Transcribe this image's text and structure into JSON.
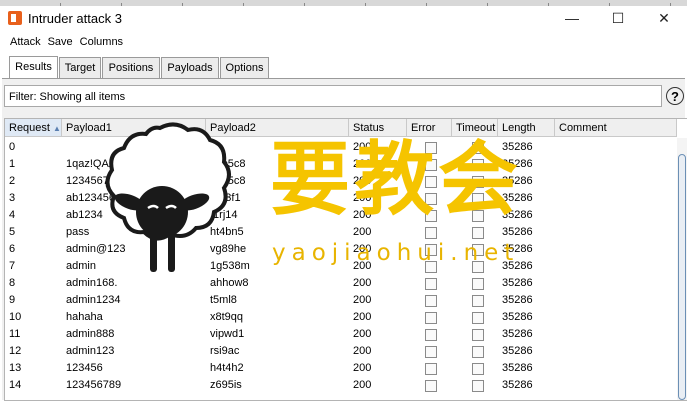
{
  "window": {
    "title": "Intruder attack 3",
    "minimize_glyph": "—",
    "maximize_glyph": "☐",
    "close_glyph": "✕"
  },
  "menu": [
    "Attack",
    "Save",
    "Columns"
  ],
  "tabs": [
    "Results",
    "Target",
    "Positions",
    "Payloads",
    "Options"
  ],
  "filter": {
    "text": "Filter: Showing all items"
  },
  "help_glyph": "?",
  "table": {
    "columns": [
      "Request",
      "Payload1",
      "Payload2",
      "Status",
      "Error",
      "Timeout",
      "Length",
      "Comment"
    ],
    "sort_indicator": "▲",
    "rows": [
      {
        "request": "0",
        "payload1": "",
        "payload2": "",
        "status": "200",
        "length": "35286"
      },
      {
        "request": "1",
        "payload1": "1qaz!QAZ",
        "payload2": "75c5c8",
        "status": "200",
        "length": "35286"
      },
      {
        "request": "2",
        "payload1": "12345678",
        "payload2": "75c5c8",
        "status": "200",
        "length": "35286"
      },
      {
        "request": "3",
        "payload1": "ab123456",
        "payload2": "25f3f1",
        "status": "200",
        "length": "35286"
      },
      {
        "request": "4",
        "payload1": "ab1234",
        "payload2": "f1rj14",
        "status": "200",
        "length": "35286"
      },
      {
        "request": "5",
        "payload1": "pass",
        "payload2": "ht4bn5",
        "status": "200",
        "length": "35286"
      },
      {
        "request": "6",
        "payload1": "admin@123",
        "payload2": "vg89he",
        "status": "200",
        "length": "35286"
      },
      {
        "request": "7",
        "payload1": "admin",
        "payload2": "1g538m",
        "status": "200",
        "length": "35286"
      },
      {
        "request": "8",
        "payload1": "admin168.",
        "payload2": "ahhow8",
        "status": "200",
        "length": "35286"
      },
      {
        "request": "9",
        "payload1": "admin1234",
        "payload2": "t5ml8",
        "status": "200",
        "length": "35286"
      },
      {
        "request": "10",
        "payload1": "hahaha",
        "payload2": "x8t9qq",
        "status": "200",
        "length": "35286"
      },
      {
        "request": "11",
        "payload1": "admin888",
        "payload2": "vipwd1",
        "status": "200",
        "length": "35286"
      },
      {
        "request": "12",
        "payload1": "admin123",
        "payload2": "rsi9ac",
        "status": "200",
        "length": "35286"
      },
      {
        "request": "13",
        "payload1": "123456",
        "payload2": "h4t4h2",
        "status": "200",
        "length": "35286"
      },
      {
        "request": "14",
        "payload1": "123456789",
        "payload2": "z695is",
        "status": "200",
        "length": "35286"
      }
    ]
  },
  "watermark": {
    "chinese": "要教会",
    "url": "yaojiaohui.net"
  },
  "colors": {
    "accent": "#e8601c",
    "watermark": "#f5c400"
  }
}
